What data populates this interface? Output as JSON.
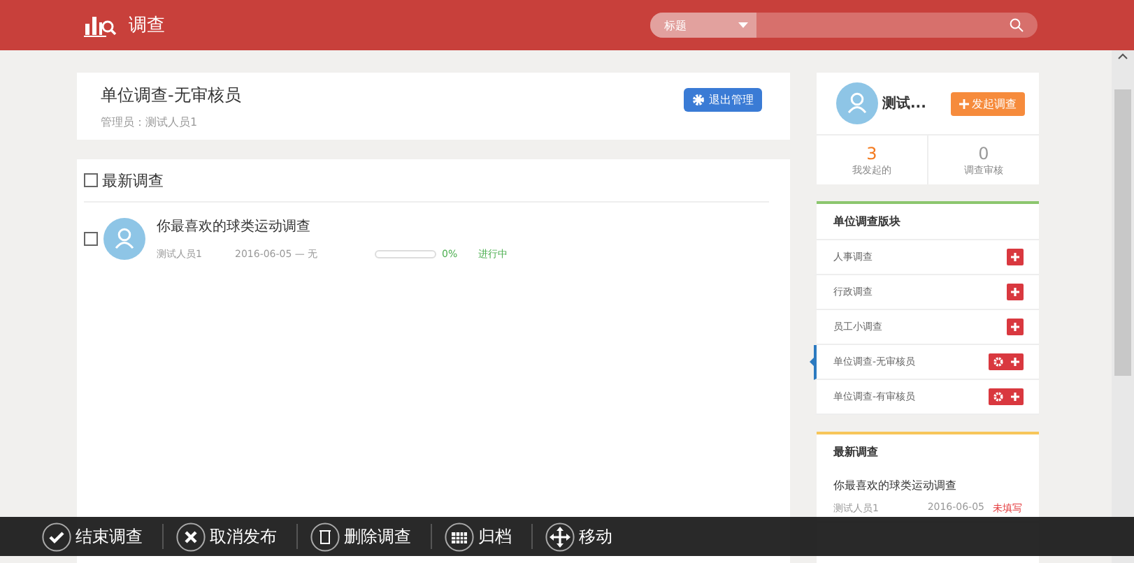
{
  "header": {
    "title": "调查",
    "search_category": "标题"
  },
  "unit": {
    "title": "单位调查-无审核员",
    "manager_label": "管理员：",
    "manager": "测试人员1",
    "exit_button": "退出管理"
  },
  "survey_list": {
    "title": "最新调查",
    "checked": false,
    "items": [
      {
        "title": "你最喜欢的球类运动调查",
        "author": "测试人员1",
        "dates": "2016-06-05 — 无",
        "level": 0,
        "percent": "0%",
        "status": "进行中",
        "checked": false
      }
    ]
  },
  "profile": {
    "name": "测试...",
    "launch_button": "发起调查",
    "stats": [
      {
        "value": "3",
        "label": "我发起的",
        "color": "#f47b20"
      },
      {
        "value": "0",
        "label": "调查审核",
        "color": "#999999"
      }
    ]
  },
  "categories": {
    "title": "单位调查版块",
    "items": [
      {
        "name": "人事调查",
        "selected": false,
        "settings": false
      },
      {
        "name": "行政调查",
        "selected": false,
        "settings": false
      },
      {
        "name": "员工小调查",
        "selected": false,
        "settings": false
      },
      {
        "name": "单位调查-无审核员",
        "selected": true,
        "settings": true
      },
      {
        "name": "单位调查-有审核员",
        "selected": false,
        "settings": true
      }
    ]
  },
  "latest": {
    "title": "最新调查",
    "items": [
      {
        "title": "你最喜欢的球类运动调查",
        "author": "测试人员1",
        "date": "2016-06-05",
        "status": "未填写"
      }
    ]
  },
  "actions": [
    {
      "kind": "check",
      "label": "结束调查"
    },
    {
      "kind": "close",
      "label": "取消发布"
    },
    {
      "kind": "trash",
      "label": "删除调查"
    },
    {
      "kind": "archive",
      "label": "归档"
    },
    {
      "kind": "move",
      "label": "移动"
    }
  ]
}
